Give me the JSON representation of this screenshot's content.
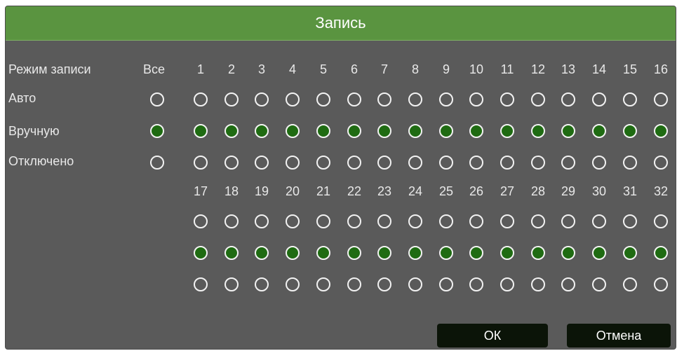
{
  "dialog": {
    "title": "Запись",
    "header_label": "Режим записи",
    "all_label": "Все",
    "modes": [
      "Авто",
      "Вручную",
      "Отключено"
    ],
    "selected_mode": "Вручную",
    "channels_row1": [
      "1",
      "2",
      "3",
      "4",
      "5",
      "6",
      "7",
      "8",
      "9",
      "10",
      "11",
      "12",
      "13",
      "14",
      "15",
      "16"
    ],
    "channels_row2": [
      "17",
      "18",
      "19",
      "20",
      "21",
      "22",
      "23",
      "24",
      "25",
      "26",
      "27",
      "28",
      "29",
      "30",
      "31",
      "32"
    ],
    "ok_label": "ОК",
    "cancel_label": "Отмена"
  },
  "colors": {
    "title_bar": "#5a9440",
    "panel": "#5a5a5a",
    "radio_selected_fill": "#1f6b12",
    "radio_border": "#f2f2f2",
    "button_bg": "#0b1408"
  }
}
